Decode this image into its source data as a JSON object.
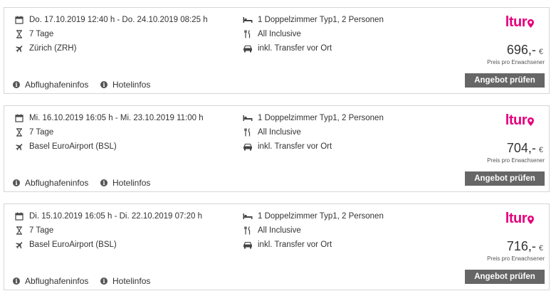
{
  "offers": [
    {
      "dates": "Do. 17.10.2019 12:40 h - Do. 24.10.2019 08:25 h",
      "duration": "7 Tage",
      "airport": "Zürich (ZRH)",
      "room": "1 Doppelzimmer Typ1, 2 Personen",
      "board": "All Inclusive",
      "transfer": "inkl. Transfer vor Ort",
      "price": "696,-",
      "currency": "€",
      "price_note": "Preis pro Erwachsener",
      "button": "Angebot prüfen",
      "airport_info": "Abflughafeninfos",
      "hotel_info": "Hotelinfos",
      "logo": "ltur"
    },
    {
      "dates": "Mi. 16.10.2019 16:05 h - Mi. 23.10.2019 11:00 h",
      "duration": "7 Tage",
      "airport": "Basel EuroAirport (BSL)",
      "room": "1 Doppelzimmer Typ1, 2 Personen",
      "board": "All Inclusive",
      "transfer": "inkl. Transfer vor Ort",
      "price": "704,-",
      "currency": "€",
      "price_note": "Preis pro Erwachsener",
      "button": "Angebot prüfen",
      "airport_info": "Abflughafeninfos",
      "hotel_info": "Hotelinfos",
      "logo": "ltur"
    },
    {
      "dates": "Di. 15.10.2019 16:05 h - Di. 22.10.2019 07:20 h",
      "duration": "7 Tage",
      "airport": "Basel EuroAirport (BSL)",
      "room": "1 Doppelzimmer Typ1, 2 Personen",
      "board": "All Inclusive",
      "transfer": "inkl. Transfer vor Ort",
      "price": "716,-",
      "currency": "€",
      "price_note": "Preis pro Erwachsener",
      "button": "Angebot prüfen",
      "airport_info": "Abflughafeninfos",
      "hotel_info": "Hotelinfos",
      "logo": "ltur"
    }
  ],
  "colors": {
    "brand": "#e6007e",
    "button_bg": "#666666",
    "border": "#d6d6d6"
  },
  "icons": [
    "calendar-icon",
    "hourglass-icon",
    "plane-icon",
    "bed-icon",
    "cutlery-icon",
    "car-icon",
    "info-icon",
    "location-pin-icon"
  ]
}
